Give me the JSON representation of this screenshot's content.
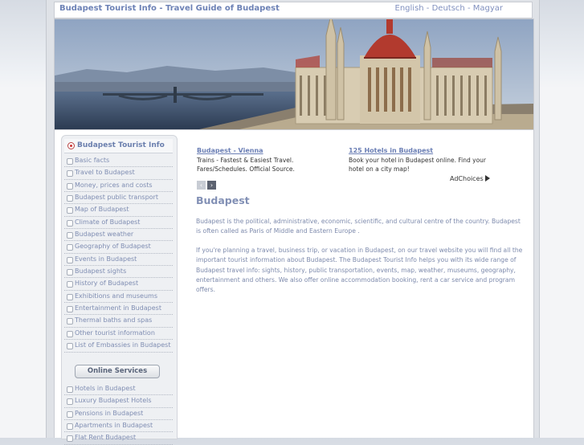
{
  "header": {
    "site_title": "Budapest Tourist Info - Travel Guide of Budapest",
    "languages": [
      "English",
      "Deutsch",
      "Magyar"
    ],
    "separator": " - "
  },
  "banner": {
    "alt": "Budapest Parliament building on the Danube"
  },
  "sidebar": {
    "title": "Budapest Tourist Info",
    "items": [
      "Basic facts",
      "Travel to Budapest",
      "Money, prices and costs",
      "Budapest public transport",
      "Map of Budapest",
      "Climate of Budapest",
      "Budapest weather",
      "Geography of Budapest",
      "Events in Budapest",
      "Budapest sights",
      "History of Budapest",
      "Exhibitions and museums",
      "Entertainment in Budapest",
      "Thermal baths and spas",
      "Other tourist information",
      "List of Embassies in Budapest"
    ],
    "services_button": "Online Services",
    "service_items": [
      "Hotels in Budapest",
      "Luxury Budapest Hotels",
      "Pensions in Budapest",
      "Apartments in Budapest",
      "Flat Rent Budapest"
    ]
  },
  "ads": [
    {
      "title": "Budapest - Vienna",
      "line1": "Trains - Fastest & Easiest Travel.",
      "line2": "Fares/Schedules. Official Source."
    },
    {
      "title": "125 Hotels in Budapest",
      "line1": "Book your hotel in Budapest online. Find your",
      "line2": "hotel on a city map!"
    }
  ],
  "ad_nav": {
    "prev": "‹",
    "next": "›"
  },
  "adchoices": "AdChoices",
  "main": {
    "heading": "Budapest",
    "para1": "Budapest is the political, administrative, economic, scientific, and cultural centre of the country. Budapest is often called as Paris of Middle and Eastern Europe .",
    "para2": "If you're planning a travel, business trip, or vacation in Budapest, on our travel website you will find all the important tourist information about Budapest. The Budapest Tourist Info helps you with its wide range of Budapest travel info: sights, history, public transportation, events, map, weather, museums, geography, entertainment and others. We also offer online accommodation booking, rent a car service and program offers."
  },
  "colors": {
    "accent": "#6b7fb5",
    "text": "#7d8aac",
    "dome": "#b23a2e"
  }
}
